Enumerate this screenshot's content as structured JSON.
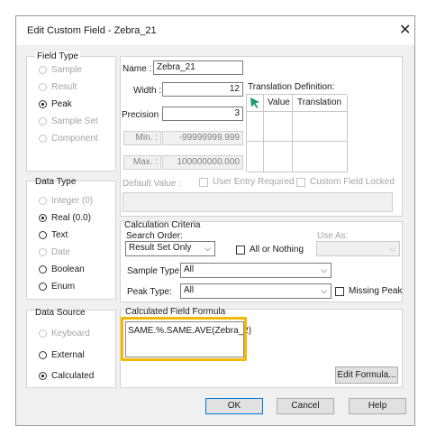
{
  "window": {
    "title": "Edit Custom Field - Zebra_21",
    "close": "✕"
  },
  "field_type": {
    "title": "Field Type",
    "options": [
      {
        "label": "Sample",
        "selected": false,
        "enabled": false
      },
      {
        "label": "Result",
        "selected": false,
        "enabled": false
      },
      {
        "label": "Peak",
        "selected": true,
        "enabled": true
      },
      {
        "label": "Sample Set",
        "selected": false,
        "enabled": false
      },
      {
        "label": "Component",
        "selected": false,
        "enabled": false
      }
    ]
  },
  "data_type": {
    "title": "Data Type",
    "options": [
      {
        "label": "Integer (0)",
        "selected": false,
        "enabled": false
      },
      {
        "label": "Real (0.0)",
        "selected": true,
        "enabled": true
      },
      {
        "label": "Text",
        "selected": false,
        "enabled": true
      },
      {
        "label": "Date",
        "selected": false,
        "enabled": false
      },
      {
        "label": "Boolean",
        "selected": false,
        "enabled": true
      },
      {
        "label": "Enum",
        "selected": false,
        "enabled": true
      }
    ]
  },
  "data_source": {
    "title": "Data Source",
    "options": [
      {
        "label": "Keyboard",
        "selected": false,
        "enabled": false
      },
      {
        "label": "External",
        "selected": false,
        "enabled": true
      },
      {
        "label": "Calculated",
        "selected": true,
        "enabled": true
      }
    ]
  },
  "props": {
    "name_label": "Name :",
    "name_value": "Zebra_21",
    "width_label": "Width :",
    "width_value": "12",
    "precision_label": "Precision :",
    "precision_value": "3",
    "min_label": "Min. :",
    "min_value": "-99999999.999",
    "max_label": "Max. :",
    "max_value": "100000000.000",
    "default_label": "Default Value :",
    "user_entry_label": "User Entry Required",
    "locked_label": "Custom Field Locked"
  },
  "translation": {
    "title": "Translation Definition:",
    "col_value": "Value",
    "col_translation": "Translation"
  },
  "calc": {
    "title": "Calculation Criteria",
    "search_order_label": "Search Order:",
    "search_order_value": "Result Set Only",
    "use_as_label": "Use As:",
    "all_or_nothing_label": "All or Nothing",
    "sample_type_label": "Sample Type:",
    "sample_type_value": "All",
    "peak_type_label": "Peak Type:",
    "peak_type_value": "All",
    "missing_peak_label": "Missing Peak"
  },
  "formula": {
    "title": "Calculated Field Formula",
    "text": "SAME.%.SAME.AVE(Zebra_2)",
    "highlight_color": "#f5b800",
    "edit_button": "Edit Formula..."
  },
  "buttons": {
    "ok": "OK",
    "cancel": "Cancel",
    "help": "Help"
  },
  "icons": {
    "close": "close-icon",
    "translation": "pointer-arrow-icon",
    "dropdown": "chevron-down-icon"
  }
}
